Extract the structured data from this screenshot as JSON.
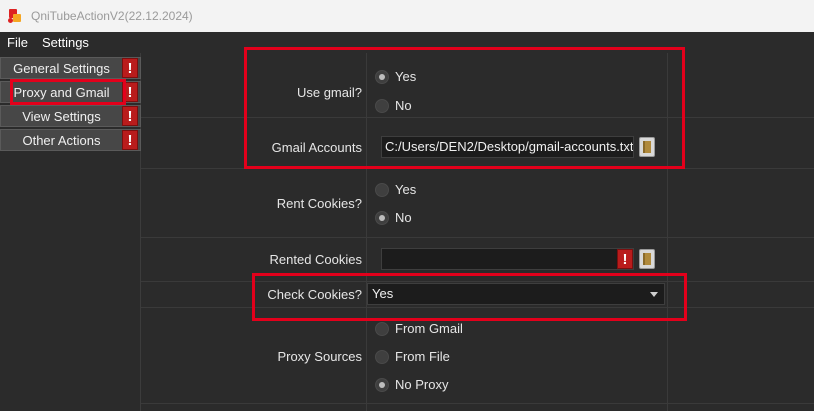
{
  "window": {
    "title": "QniTubeActionV2(22.12.2024)"
  },
  "menu": {
    "file": "File",
    "settings": "Settings"
  },
  "sidebar": {
    "items": [
      {
        "label": "General Settings",
        "warning": "!"
      },
      {
        "label": "Proxy and Gmail",
        "warning": "!"
      },
      {
        "label": "View Settings",
        "warning": "!"
      },
      {
        "label": "Other Actions",
        "warning": "!"
      }
    ]
  },
  "form": {
    "use_gmail": {
      "label": "Use gmail?",
      "yes": "Yes",
      "no": "No",
      "selected": "Yes"
    },
    "gmail_accounts": {
      "label": "Gmail Accounts",
      "value": "C:/Users/DEN2/Desktop/gmail-accounts.txt"
    },
    "rent_cookies": {
      "label": "Rent Cookies?",
      "yes": "Yes",
      "no": "No",
      "selected": "No"
    },
    "rented_cookies": {
      "label": "Rented Cookies",
      "value": "",
      "warning": "!"
    },
    "check_cookies": {
      "label": "Check Cookies?",
      "value": "Yes"
    },
    "proxy_sources": {
      "label": "Proxy Sources",
      "options": [
        "From Gmail",
        "From File",
        "No Proxy"
      ],
      "selected": "No Proxy"
    }
  },
  "colors": {
    "highlight": "#e3001b",
    "warning": "#b91c1c",
    "background": "#2b2b2b"
  },
  "icons": {
    "folder": "folder-browse-icon",
    "warning": "exclamation-icon",
    "app": "app-logo-icon"
  }
}
